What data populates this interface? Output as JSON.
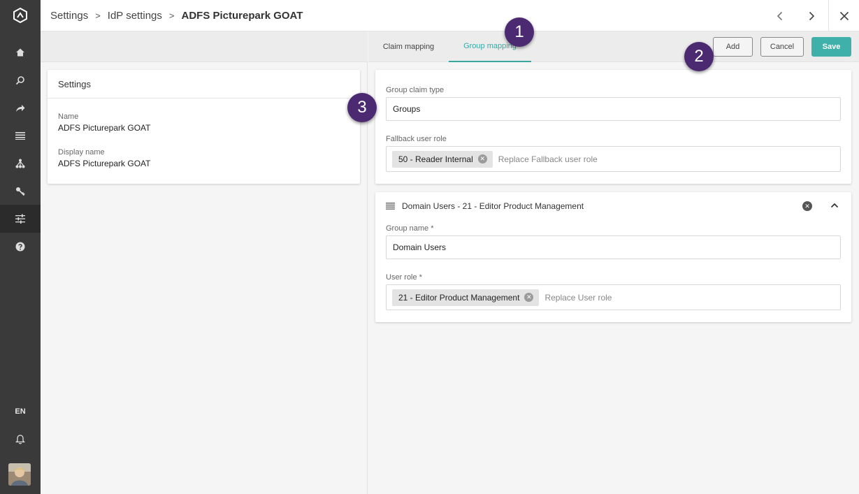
{
  "app": {
    "language": "EN"
  },
  "breadcrumb": {
    "items": [
      "Settings",
      "IdP settings"
    ],
    "current": "ADFS Picturepark GOAT",
    "separator": ">"
  },
  "left_panel": {
    "title": "Settings",
    "fields": [
      {
        "label": "Name",
        "value": "ADFS Picturepark GOAT"
      },
      {
        "label": "Display name",
        "value": "ADFS Picturepark GOAT"
      }
    ]
  },
  "tabs": [
    {
      "label": "Claim mapping",
      "active": false
    },
    {
      "label": "Group mapping",
      "active": true
    }
  ],
  "actions": {
    "add": "Add",
    "cancel": "Cancel",
    "save": "Save"
  },
  "group_settings": {
    "claim_type_label": "Group claim type",
    "claim_type_value": "Groups",
    "fallback_label": "Fallback user role",
    "fallback_chip": "50 - Reader Internal",
    "fallback_placeholder": "Replace Fallback user role"
  },
  "group_mapping": {
    "title": "Domain Users - 21 - Editor Product Management",
    "group_name_label": "Group name *",
    "group_name_value": "Domain Users",
    "user_role_label": "User role *",
    "user_role_chip": "21 - Editor Product Management",
    "user_role_placeholder": "Replace User role"
  },
  "callouts": [
    "1",
    "2",
    "3"
  ],
  "icons": {
    "rail": [
      "logo-icon",
      "home-icon",
      "search-icon",
      "share-icon",
      "list-icon",
      "hierarchy-icon",
      "key-icon",
      "settings-sliders-icon",
      "help-icon",
      "bell-icon"
    ],
    "top": [
      "chevron-left-icon",
      "chevron-right-icon",
      "close-icon"
    ]
  },
  "colors": {
    "accent": "#39a8a3",
    "save_button": "#3fb0aa",
    "rail": "#3a3a3a",
    "callout": "#4b2a72"
  }
}
